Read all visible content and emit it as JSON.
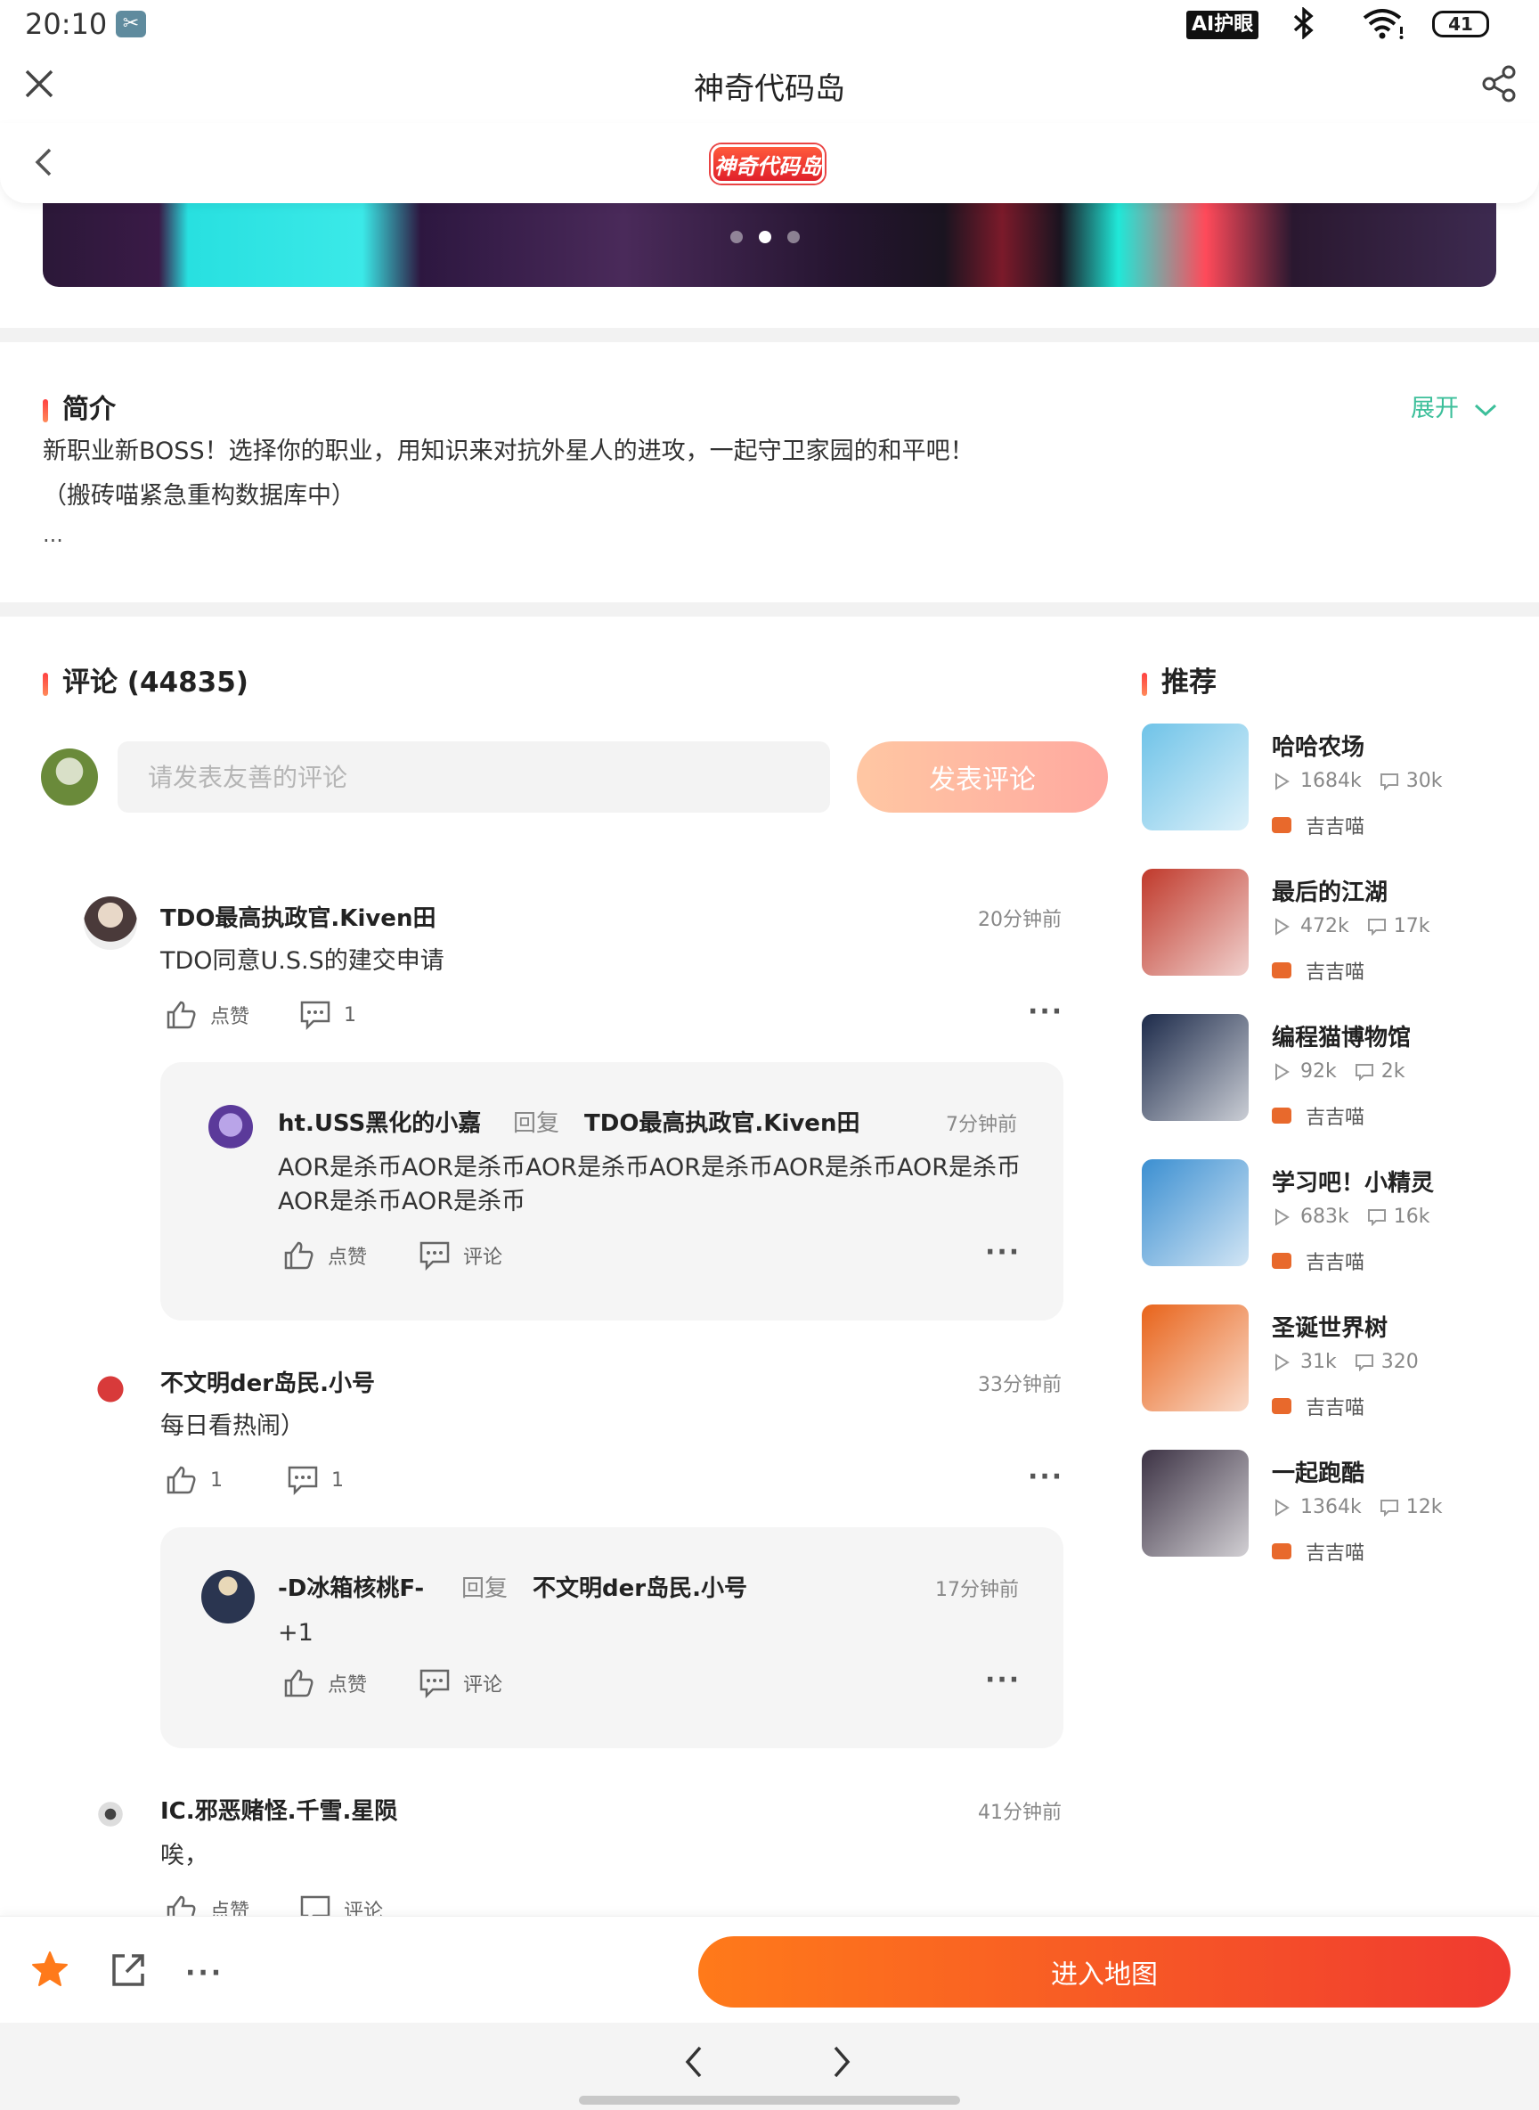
{
  "status_bar": {
    "time": "20:10",
    "ai_label": "AI护眼",
    "battery": "41"
  },
  "title_bar": {
    "title": "神奇代码岛"
  },
  "inner_header": {
    "logo_text": "神奇代码岛"
  },
  "banner": {
    "dots": 3,
    "active_dot": 2
  },
  "intro": {
    "title": "简介",
    "expand_label": "展开",
    "line1": "新职业新BOSS！选择你的职业，用知识来对抗外星人的进攻，一起守卫家园的和平吧！",
    "line2": "（搬砖喵紧急重构数据库中）",
    "line3": "..."
  },
  "comments": {
    "title": "评论 (44835)",
    "input_placeholder": "请发表友善的评论",
    "post_button": "发表评论",
    "like_label": "点赞",
    "comment_label": "评论",
    "reply_word": "回复",
    "items": [
      {
        "name": "TDO最高执政官.Kiven田",
        "time": "20分钟前",
        "text": "TDO同意U.S.S的建交申请",
        "like_count": "点赞",
        "reply_count": "1",
        "reply": {
          "name": "ht.USS黑化的小嘉",
          "to": "TDO最高执政官.Kiven田",
          "time": "7分钟前",
          "text_line1": "AOR是杀币AOR是杀币AOR是杀币AOR是杀币AOR是杀币AOR是杀币",
          "text_line2": "AOR是杀币AOR是杀币"
        }
      },
      {
        "name": "不文明der岛民.小号",
        "time": "33分钟前",
        "text": "每日看热闹）",
        "like_count": "1",
        "reply_count": "1",
        "reply": {
          "name": "-D冰箱核桃F-",
          "to": "不文明der岛民.小号",
          "time": "17分钟前",
          "text_line1": "+1",
          "text_line2": ""
        }
      },
      {
        "name": "IC.邪恶赌怪.千雪.星陨",
        "time": "41分钟前",
        "text": "唉，"
      }
    ]
  },
  "recommend": {
    "title": "推荐",
    "items": [
      {
        "name": "哈哈农场",
        "plays": "1684k",
        "comments": "30k",
        "author": "吉吉喵",
        "color": "#6fc3e8"
      },
      {
        "name": "最后的江湖",
        "plays": "472k",
        "comments": "17k",
        "author": "吉吉喵",
        "color": "#c0392b"
      },
      {
        "name": "编程猫博物馆",
        "plays": "92k",
        "comments": "2k",
        "author": "吉吉喵",
        "color": "#1c2a4a"
      },
      {
        "name": "学习吧！小精灵",
        "plays": "683k",
        "comments": "16k",
        "author": "吉吉喵",
        "color": "#3b8fd1"
      },
      {
        "name": "圣诞世界树",
        "plays": "31k",
        "comments": "320",
        "author": "吉吉喵",
        "color": "#e8631a"
      },
      {
        "name": "一起跑酷",
        "plays": "1364k",
        "comments": "12k",
        "author": "吉吉喵",
        "color": "#3c3244"
      }
    ]
  },
  "bottom_bar": {
    "enter_button": "进入地图"
  }
}
